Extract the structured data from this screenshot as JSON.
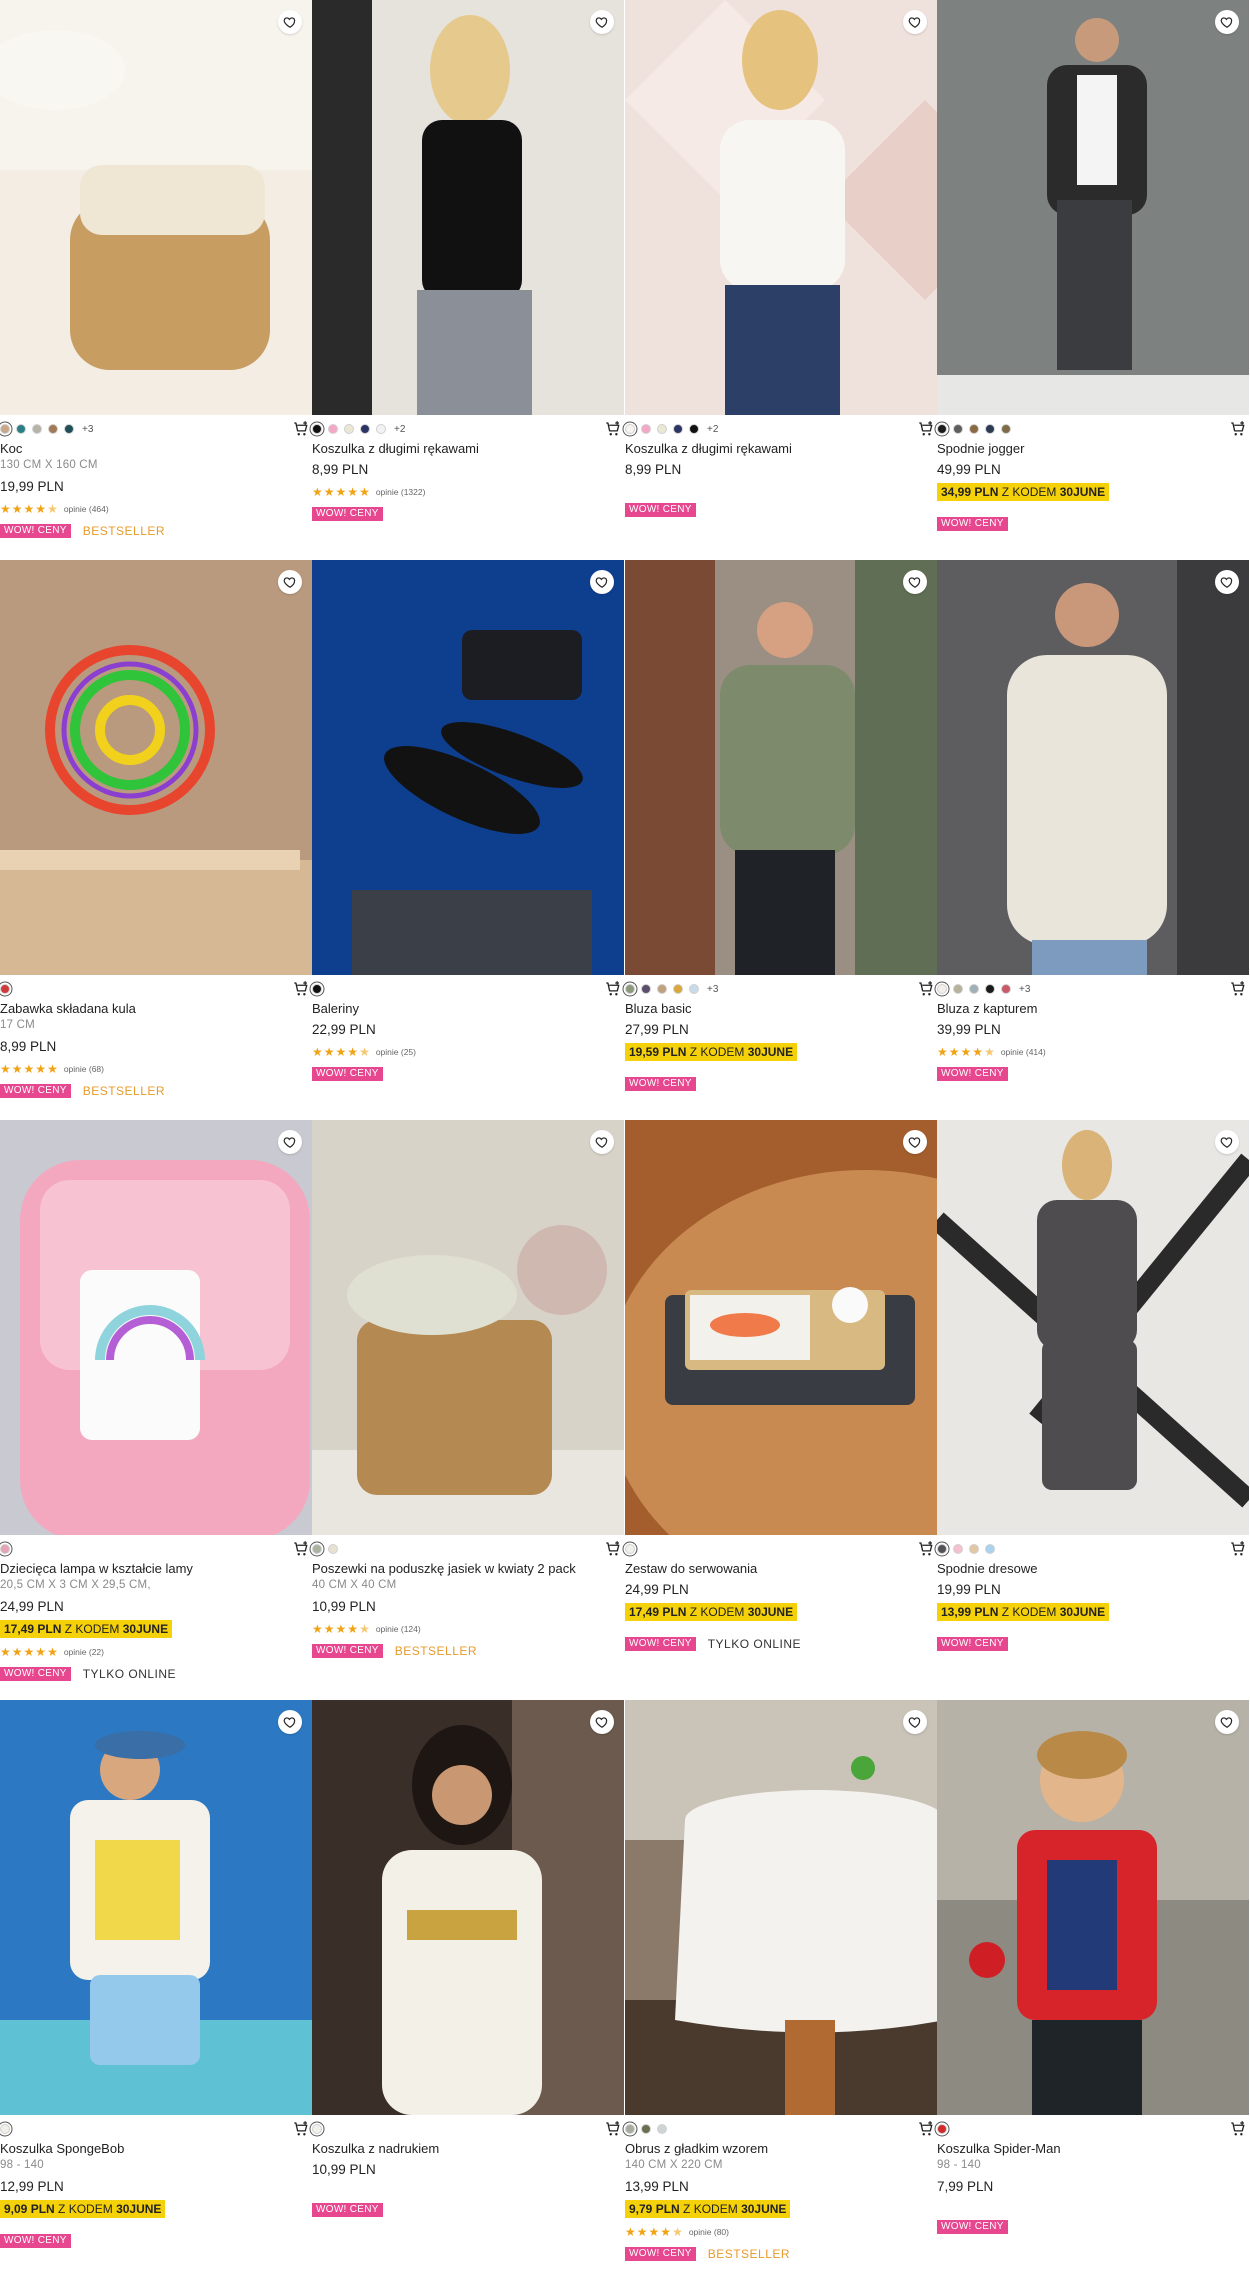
{
  "products": [
    {
      "name": "Koc",
      "size": "130 CM X 160 CM",
      "price": "19,99 PLN",
      "promo": null,
      "rating": {
        "stars": 4.5,
        "text": "opinie (464)"
      },
      "badges": {
        "wow": "WOW! CENY",
        "extra": "BESTSELLER",
        "extra_type": "best"
      },
      "swatches": [
        "#c9a88a",
        "#2a7f86",
        "#b8b3a8",
        "#a37a57",
        "#1f4f59"
      ],
      "more": "+3",
      "colors": {
        "bg": "#f3ede3",
        "accent": "#c79d62"
      }
    },
    {
      "name": "Koszulka z długimi rękawami",
      "size": null,
      "price": "8,99 PLN",
      "promo": null,
      "rating": {
        "stars": 5,
        "text": "opinie (1322)"
      },
      "badges": {
        "wow": "WOW! CENY",
        "extra": null,
        "extra_type": null
      },
      "swatches": [
        "#111111",
        "#f4a7c6",
        "#ebe7d5",
        "#2b3565",
        "#f2f2f2"
      ],
      "more": "+2",
      "colors": {
        "bg": "#e6e2dc",
        "accent": "#111111"
      }
    },
    {
      "name": "Koszulka z długimi rękawami",
      "size": null,
      "price": "8,99 PLN",
      "promo": null,
      "rating": null,
      "badges": {
        "wow": "WOW! CENY",
        "extra": null,
        "extra_type": null
      },
      "swatches": [
        "#f7f3ee",
        "#f4a7c6",
        "#ebe7d5",
        "#2b3565",
        "#111111"
      ],
      "more": "+2",
      "colors": {
        "bg": "#efe2dd",
        "accent": "#f8f6f2"
      }
    },
    {
      "name": "Spodnie jogger",
      "size": null,
      "price": "49,99 PLN",
      "promo": {
        "price": "34,99 PLN",
        "mid": "Z KODEM",
        "code": "30JUNE"
      },
      "rating": null,
      "badges": {
        "wow": "WOW! CENY",
        "extra": null,
        "extra_type": null
      },
      "swatches": [
        "#1b1b1b",
        "#5e5e5e",
        "#8a6a44",
        "#2b3b52",
        "#7d6c47"
      ],
      "more": null,
      "colors": {
        "bg": "#7d8281",
        "accent": "#2b2b2b"
      }
    },
    {
      "name": "Zabawka składana kula",
      "size": "17 CM",
      "price": "8,99 PLN",
      "promo": null,
      "rating": {
        "stars": 5,
        "text": "opinie (68)"
      },
      "badges": {
        "wow": "WOW! CENY",
        "extra": "BESTSELLER",
        "extra_type": "best"
      },
      "swatches": [
        "#d13a3a"
      ],
      "more": null,
      "colors": {
        "bg": "#b99a7e",
        "accent": "#e8452f"
      }
    },
    {
      "name": "Baleriny",
      "size": null,
      "price": "22,99 PLN",
      "promo": null,
      "rating": {
        "stars": 4.5,
        "text": "opinie (25)"
      },
      "badges": {
        "wow": "WOW! CENY",
        "extra": null,
        "extra_type": null
      },
      "swatches": [
        "#111111"
      ],
      "more": null,
      "colors": {
        "bg": "#0e3f8f",
        "accent": "#121212"
      }
    },
    {
      "name": "Bluza basic",
      "size": null,
      "price": "27,99 PLN",
      "promo": {
        "price": "19,59 PLN",
        "mid": "Z KODEM",
        "code": "30JUNE"
      },
      "rating": null,
      "badges": {
        "wow": "WOW! CENY",
        "extra": null,
        "extra_type": null
      },
      "swatches": [
        "#8c9a7c",
        "#5a4e6b",
        "#c0a27e",
        "#d9a73b",
        "#c9dbe8"
      ],
      "more": "+3",
      "colors": {
        "bg": "#9a8f82",
        "accent": "#7d8a6c"
      }
    },
    {
      "name": "Bluza z kapturem",
      "size": null,
      "price": "39,99 PLN",
      "promo": null,
      "rating": {
        "stars": 4.5,
        "text": "opinie (414)"
      },
      "badges": {
        "wow": "WOW! CENY",
        "extra": null,
        "extra_type": null
      },
      "swatches": [
        "#f1efe8",
        "#b8b29c",
        "#9fb0b8",
        "#1b1b1b",
        "#c85a6a"
      ],
      "more": "+3",
      "colors": {
        "bg": "#5d5d60",
        "accent": "#e9e5da"
      }
    },
    {
      "name": "Dziecięca lampa w kształcie lamy",
      "size": "20,5 CM X 3 CM X 29,5 CM,",
      "price": "24,99 PLN",
      "promo": {
        "price": "17,49 PLN",
        "mid": "Z KODEM",
        "code": "30JUNE"
      },
      "rating": {
        "stars": 5,
        "text": "opinie (22)"
      },
      "badges": {
        "wow": "WOW! CENY",
        "extra": "TYLKO ONLINE",
        "extra_type": "online"
      },
      "swatches": [
        "#e5a3b5"
      ],
      "more": null,
      "colors": {
        "bg": "#c9c9d1",
        "accent": "#f4a8bf"
      }
    },
    {
      "name": "Poszewki na poduszkę jasiek w kwiaty 2 pack",
      "size": "40 CM X 40 CM",
      "price": "10,99 PLN",
      "promo": null,
      "rating": {
        "stars": 4.5,
        "text": "opinie (124)"
      },
      "badges": {
        "wow": "WOW! CENY",
        "extra": "BESTSELLER",
        "extra_type": "best"
      },
      "swatches": [
        "#aab3a0",
        "#e8e1d1"
      ],
      "more": null,
      "colors": {
        "bg": "#d8d3c9",
        "accent": "#b48a52"
      }
    },
    {
      "name": "Zestaw do serwowania",
      "size": null,
      "price": "24,99 PLN",
      "promo": {
        "price": "17,49 PLN",
        "mid": "Z KODEM",
        "code": "30JUNE"
      },
      "rating": null,
      "badges": {
        "wow": "WOW! CENY",
        "extra": "TYLKO ONLINE",
        "extra_type": "online"
      },
      "swatches": [
        "#f0efe9"
      ],
      "more": null,
      "colors": {
        "bg": "#a45e2d",
        "accent": "#f2f1ec"
      }
    },
    {
      "name": "Spodnie dresowe",
      "size": null,
      "price": "19,99 PLN",
      "promo": {
        "price": "13,99 PLN",
        "mid": "Z KODEM",
        "code": "30JUNE"
      },
      "rating": null,
      "badges": {
        "wow": "WOW! CENY",
        "extra": null,
        "extra_type": null
      },
      "swatches": [
        "#55525a",
        "#f4c1cf",
        "#e2c7a3",
        "#a9d3ee"
      ],
      "more": null,
      "colors": {
        "bg": "#e9e7e4",
        "accent": "#4f4c50"
      }
    },
    {
      "name": "Koszulka SpongeBob",
      "size": "98 - 140",
      "price": "12,99 PLN",
      "promo": {
        "price": "9,09 PLN",
        "mid": "Z KODEM",
        "code": "30JUNE"
      },
      "rating": null,
      "badges": {
        "wow": "WOW! CENY",
        "extra": null,
        "extra_type": null
      },
      "swatches": [
        "#f2efe8"
      ],
      "more": null,
      "colors": {
        "bg": "#2c78c2",
        "accent": "#f4f2ea"
      }
    },
    {
      "name": "Koszulka z nadrukiem",
      "size": null,
      "price": "10,99 PLN",
      "promo": null,
      "rating": null,
      "badges": {
        "wow": "WOW! CENY",
        "extra": null,
        "extra_type": null
      },
      "swatches": [
        "#f2f0ea"
      ],
      "more": null,
      "colors": {
        "bg": "#3a2e28",
        "accent": "#f3f0e8"
      }
    },
    {
      "name": "Obrus z gładkim wzorem",
      "size": "140 CM X 220 CM",
      "price": "13,99 PLN",
      "promo": {
        "price": "9,79 PLN",
        "mid": "Z KODEM",
        "code": "30JUNE"
      },
      "rating": {
        "stars": 4.5,
        "text": "opinie (80)"
      },
      "badges": {
        "wow": "WOW! CENY",
        "extra": "BESTSELLER",
        "extra_type": "best"
      },
      "swatches": [
        "#a7aca0",
        "#6c6e52",
        "#cfd4d6"
      ],
      "more": null,
      "colors": {
        "bg": "#8b7a6a",
        "accent": "#f4f2ee"
      }
    },
    {
      "name": "Koszulka Spider-Man",
      "size": "98 - 140",
      "price": "7,99 PLN",
      "promo": null,
      "rating": null,
      "badges": {
        "wow": "WOW! CENY",
        "extra": null,
        "extra_type": null
      },
      "swatches": [
        "#d12a2a"
      ],
      "more": null,
      "colors": {
        "bg": "#8d8a82",
        "accent": "#d7242a"
      }
    }
  ]
}
